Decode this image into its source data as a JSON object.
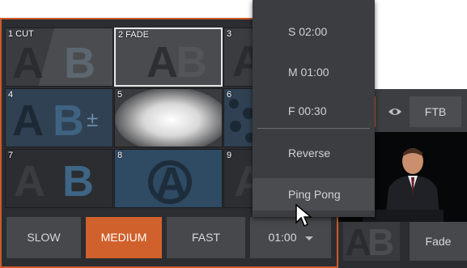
{
  "tiles": [
    {
      "num": "1 CUT"
    },
    {
      "num": "2 FADE"
    },
    {
      "num": "3"
    },
    {
      "num": "4"
    },
    {
      "num": "5"
    },
    {
      "num": "6"
    },
    {
      "num": "7"
    },
    {
      "num": "8"
    },
    {
      "num": "9"
    }
  ],
  "tile_glyph_a": "A",
  "tile_glyph_b": "B",
  "speed": {
    "slow": "SLOW",
    "medium": "MEDIUM",
    "fast": "FAST",
    "duration": "01:00",
    "selected": "MEDIUM"
  },
  "menu": {
    "items": [
      "S  02:00",
      "M  01:00",
      "F  00:30",
      "Reverse",
      "Ping Pong"
    ],
    "hovered": "Ping Pong"
  },
  "right": {
    "ftb": "FTB",
    "fade": "Fade"
  },
  "colors": {
    "accent": "#d0612c",
    "panel": "#2c2d30",
    "button": "#46484c",
    "menu": "#3b3d41"
  }
}
